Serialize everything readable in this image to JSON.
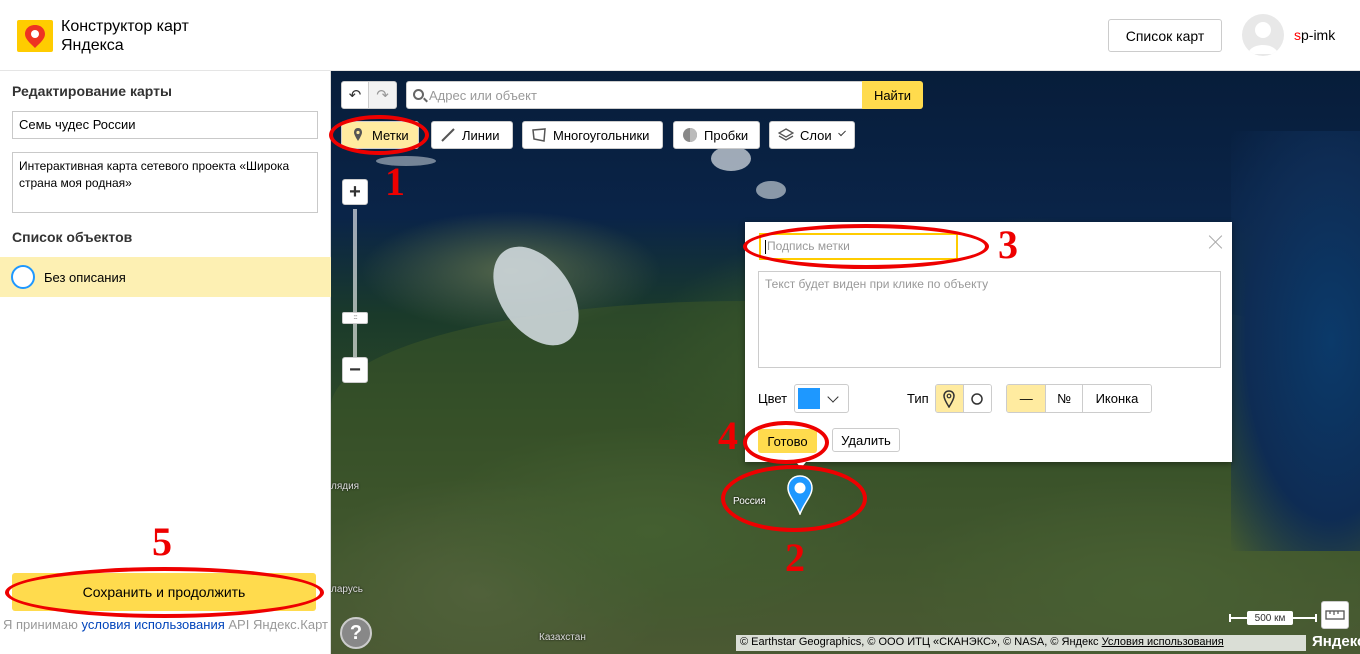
{
  "header": {
    "title": "Конструктор карт Яндекса",
    "maps_list_label": "Список карт",
    "username_first": "s",
    "username_rest": "p-imk"
  },
  "sidebar": {
    "edit_title": "Редактирование карты",
    "map_name": "Семь чудес России",
    "map_description": "Интерактивная карта сетевого проекта «Широка страна моя родная»",
    "objects_title": "Список объектов",
    "objects": [
      {
        "label": "Без описания"
      }
    ],
    "save_label": "Сохранить и продолжить",
    "terms_prefix": "Я принимаю",
    "terms_link": "условия использования",
    "terms_suffix": "API Яндекс.Карт"
  },
  "toolbar": {
    "search_placeholder": "Адрес или объект",
    "search_button": "Найти",
    "tools": {
      "marks": "Метки",
      "lines": "Линии",
      "polygons": "Многоугольники",
      "traffic": "Пробки",
      "layers": "Слои"
    }
  },
  "balloon": {
    "caption_placeholder": "Подпись метки",
    "description_placeholder": "Текст будет виден при клике по объекту",
    "color_label": "Цвет",
    "color_value": "#1e98ff",
    "type_label": "Тип",
    "content_dash": "—",
    "content_number": "№",
    "content_icon": "Иконка",
    "done_label": "Готово",
    "delete_label": "Удалить"
  },
  "map": {
    "country_label": "Россия",
    "labels": {
      "left_a": "лядия",
      "left_b": "ларусь",
      "kazakhstan": "Казахстан"
    },
    "scale_label": "500 км",
    "copyright_text": "© Earthstar Geographics, © ООО ИТЦ «СКАНЭКС», © NASA, © Яндекс",
    "copyright_link": "Условия использования",
    "brand": "Яндекс",
    "help_label": "?"
  },
  "annotations": [
    "1",
    "2",
    "3",
    "4",
    "5"
  ],
  "colors": {
    "accent_yellow": "#ffdb4d",
    "selected_yellow": "#ffeba0",
    "placemark_blue": "#1e98ff",
    "annotation_red": "#e00000"
  }
}
